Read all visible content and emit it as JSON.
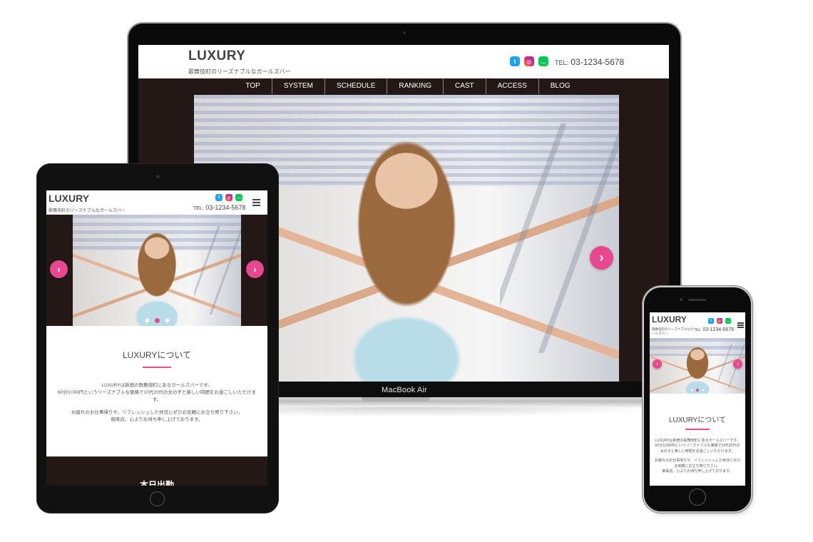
{
  "site": {
    "logo": "LUXURY",
    "tagline": "歌舞伎町のリーズナブルなガールズバー",
    "tel_label": "TEL:",
    "tel_number": "03-1234-5678",
    "accent_color": "#e8488f",
    "nav_bg_color": "#231815"
  },
  "social": [
    {
      "name": "twitter",
      "glyph": "t"
    },
    {
      "name": "instagram",
      "glyph": "◎"
    },
    {
      "name": "line",
      "glyph": "…"
    }
  ],
  "nav": {
    "items": [
      {
        "label": "TOP"
      },
      {
        "label": "SYSTEM"
      },
      {
        "label": "SCHEDULE"
      },
      {
        "label": "RANKING"
      },
      {
        "label": "CAST"
      },
      {
        "label": "ACCESS"
      },
      {
        "label": "BLOG"
      }
    ]
  },
  "slider": {
    "prev_glyph": "‹",
    "next_glyph": "›",
    "slide_count": 3,
    "active_index": 1
  },
  "about": {
    "title": "LUXURYについて",
    "paragraph1_line1": "LUXURYは新宿の歌舞伎町にあるガールズバーです。",
    "paragraph1_line2": "60分3,000円というリーズナブルな価格で10代20代の女の子と楽しい時間をお過ごしいただけます。",
    "paragraph2_line1": "お疲れのお仕事帰りや、リフレッシュした休日にぜひお気軽にお立ち寄り下さい。",
    "paragraph2_line2": "御来店、心よりお待ち申し上げております。"
  },
  "today_section": {
    "title": "本日出勤"
  },
  "devices": {
    "laptop_label": "MacBook Air"
  }
}
